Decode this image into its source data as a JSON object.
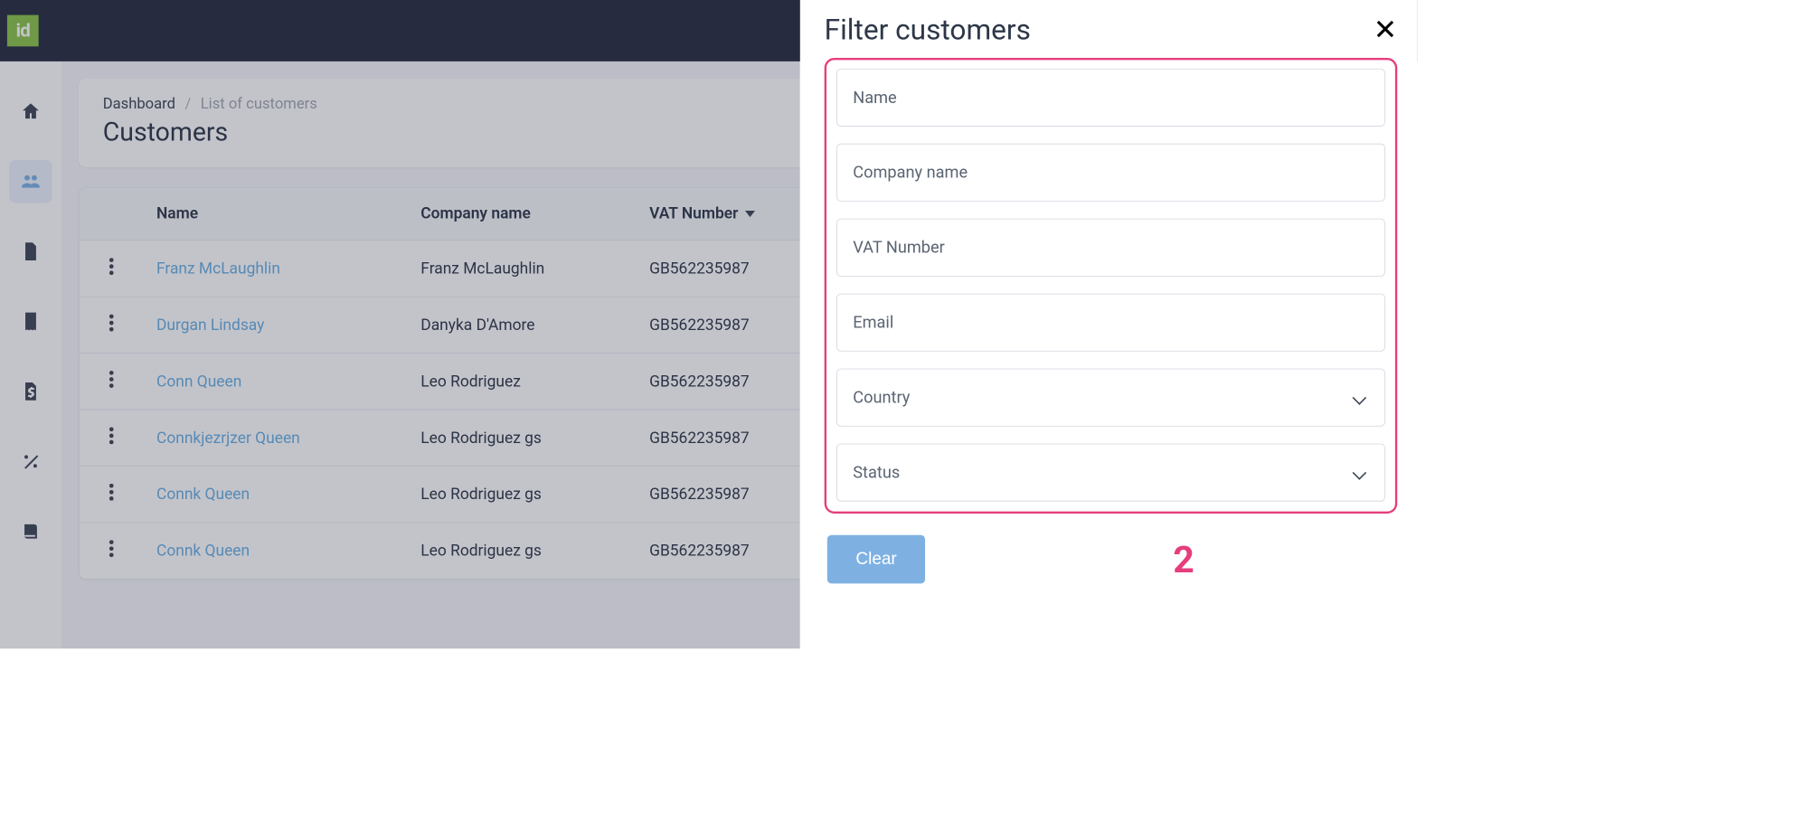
{
  "logo_text": "id",
  "breadcrumb": {
    "root": "Dashboard",
    "sep": "/",
    "current": "List of customers"
  },
  "page_title": "Customers",
  "table": {
    "headers": {
      "name": "Name",
      "company": "Company name",
      "vat": "VAT Number"
    },
    "rows": [
      {
        "name": "Franz McLaughlin",
        "company": "Franz McLaughlin",
        "vat": "GB562235987"
      },
      {
        "name": "Durgan Lindsay",
        "company": "Danyka D'Amore",
        "vat": "GB562235987"
      },
      {
        "name": "Conn Queen",
        "company": "Leo Rodriguez",
        "vat": "GB562235987"
      },
      {
        "name": "Connkjezrjzer Queen",
        "company": "Leo Rodriguez gs",
        "vat": "GB562235987"
      },
      {
        "name": "Connk Queen",
        "company": "Leo Rodriguez gs",
        "vat": "GB562235987"
      },
      {
        "name": "Connk Queen",
        "company": "Leo Rodriguez gs",
        "vat": "GB562235987"
      }
    ]
  },
  "panel": {
    "title": "Filter customers",
    "fields": {
      "name": "Name",
      "company": "Company name",
      "vat": "VAT Number",
      "email": "Email",
      "country": "Country",
      "status": "Status"
    },
    "clear": "Clear",
    "annotation_number": "2"
  }
}
